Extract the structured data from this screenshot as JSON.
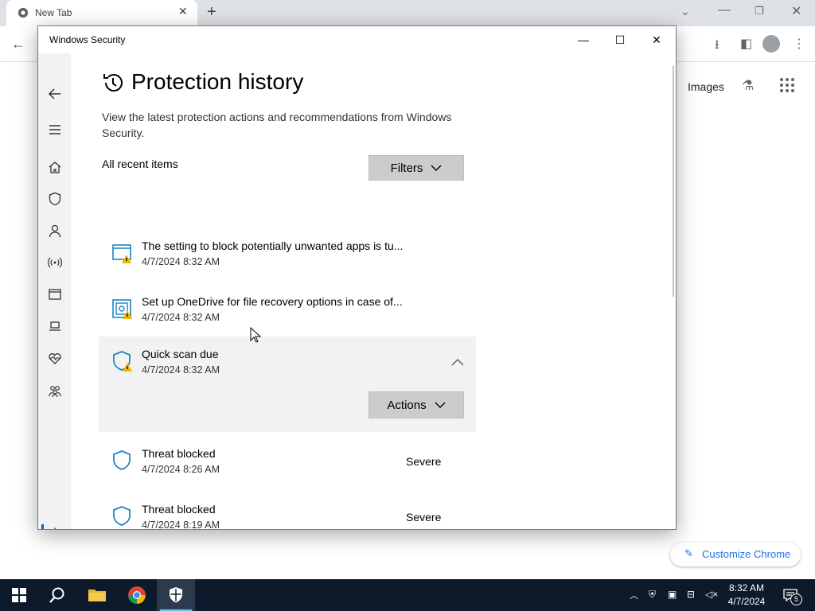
{
  "browser": {
    "tab_title": "New Tab",
    "tab_close": "✕",
    "new_tab": "+",
    "images_link": "Images",
    "customize_label": "Customize Chrome"
  },
  "window": {
    "title": "Windows Security",
    "minimize": "—",
    "maximize": "☐",
    "close": "✕"
  },
  "nav": {
    "items": [
      "back-icon",
      "menu-icon",
      "home-icon",
      "virus-protection-icon",
      "account-protection-icon",
      "firewall-icon",
      "app-browser-control-icon",
      "device-security-icon",
      "device-health-icon",
      "family-options-icon",
      "settings-icon"
    ]
  },
  "page": {
    "title": "Protection history",
    "description": "View the latest protection actions and recommendations from Windows Security.",
    "section_label": "All recent items",
    "filters_label": "Filters"
  },
  "history": [
    {
      "title": "The setting to block potentially unwanted apps is tu...",
      "time": "4/7/2024 8:32 AM",
      "severity": "",
      "icon": "app-browser-warning-icon"
    },
    {
      "title": "Set up OneDrive for file recovery options in case of...",
      "time": "4/7/2024 8:32 AM",
      "severity": "",
      "icon": "ransomware-warning-icon"
    },
    {
      "title": "Quick scan due",
      "time": "4/7/2024 8:32 AM",
      "severity": "",
      "icon": "shield-warning-icon",
      "expanded": true,
      "actions_label": "Actions"
    },
    {
      "title": "Threat blocked",
      "time": "4/7/2024 8:26 AM",
      "severity": "Severe",
      "icon": "shield-icon"
    },
    {
      "title": "Threat blocked",
      "time": "4/7/2024 8:19 AM",
      "severity": "Severe",
      "icon": "shield-icon"
    }
  ],
  "taskbar": {
    "time": "8:32 AM",
    "date": "4/7/2024",
    "notification_count": "5"
  },
  "colors": {
    "accent": "#0067c0",
    "shield": "#1a86c8",
    "warning": "#f2b600",
    "taskbar": "#0c1a2b"
  }
}
